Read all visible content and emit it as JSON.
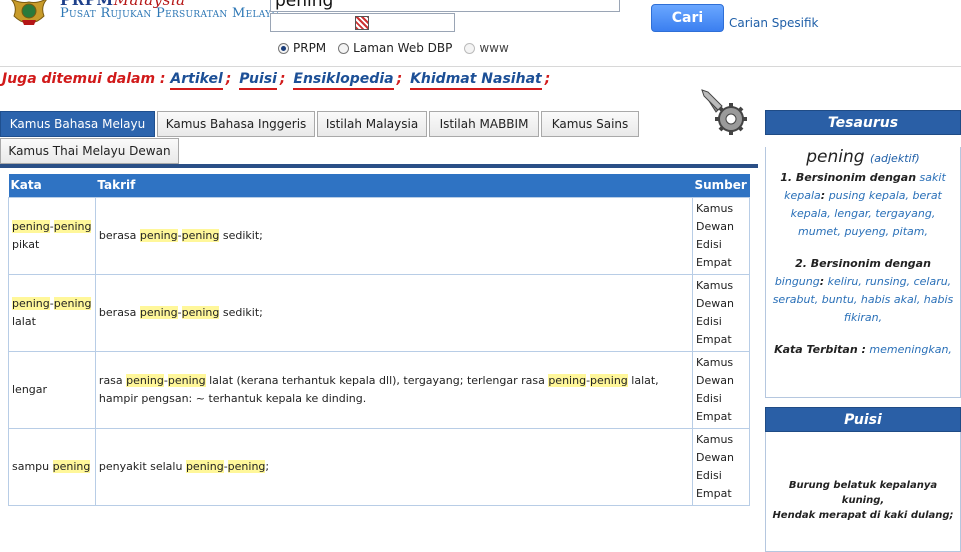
{
  "header": {
    "logo_main": "PRPM",
    "logo_tag": "Malaysia",
    "logo_sub": "Pusat Rujukan Persuratan Melayu",
    "search_value": "pening",
    "search_button": "Cari",
    "specific_link": "Carian Spesifik",
    "radios": [
      {
        "label": "PRPM",
        "checked": true
      },
      {
        "label": "Laman Web DBP",
        "checked": false
      },
      {
        "label": "www",
        "checked": false
      }
    ]
  },
  "also_found": {
    "prefix": "Juga ditemui dalam :",
    "links": [
      "Artikel",
      "Puisi",
      "Ensiklopedia",
      "Khidmat Nasihat"
    ],
    "sep": ";"
  },
  "tabs": [
    {
      "label": "Kamus Bahasa Melayu",
      "active": true
    },
    {
      "label": "Kamus Bahasa Inggeris",
      "active": false
    },
    {
      "label": "Istilah Malaysia",
      "active": false
    },
    {
      "label": "Istilah MABBIM",
      "active": false
    },
    {
      "label": "Kamus Sains",
      "active": false
    },
    {
      "label": "Kamus Thai Melayu Dewan",
      "active": false
    }
  ],
  "table": {
    "headers": {
      "kata": "Kata",
      "takrif": "Takrif",
      "sumber": "Sumber"
    },
    "rows": [
      {
        "kata": {
          "hl1": "pening",
          "dash": "-",
          "hl2": "pening",
          "rest": " pikat"
        },
        "takrif": {
          "pre": "berasa ",
          "hl1": "pening",
          "dash": "-",
          "hl2": "pening",
          "post": " sedikit;"
        },
        "sumber": [
          "Kamus",
          "Dewan",
          "Edisi",
          "Empat"
        ]
      },
      {
        "kata": {
          "hl1": "pening",
          "dash": "-",
          "hl2": "pening",
          "rest": " lalat"
        },
        "takrif": {
          "pre": "berasa ",
          "hl1": "pening",
          "dash": "-",
          "hl2": "pening",
          "post": " sedikit;"
        },
        "sumber": [
          "Kamus",
          "Dewan",
          "Edisi",
          "Empat"
        ]
      },
      {
        "kata": {
          "plain": "lengar"
        },
        "takrif": {
          "pre": "rasa ",
          "hl1": "pening",
          "dash": "-",
          "hl2": "pening",
          "mid": " lalat (kerana terhantuk kepala dll), tergayang; terlengar rasa ",
          "hl3": "pening",
          "dash2": "-",
          "hl4": "pening",
          "post": " lalat, hampir pengsan: ~ terhantuk kepala ke dinding."
        },
        "sumber": [
          "Kamus",
          "Dewan",
          "Edisi",
          "Empat"
        ]
      },
      {
        "kata": {
          "plain": "sampu ",
          "hl1": "pening"
        },
        "takrif": {
          "pre": "penyakit selalu ",
          "hl1": "pening",
          "dash": "-",
          "hl2": "pening",
          "post": ";"
        },
        "sumber": [
          "Kamus",
          "Dewan",
          "Edisi",
          "Empat"
        ]
      }
    ]
  },
  "tesaurus": {
    "title": "Tesaurus",
    "word": "pening",
    "pos": "(adjektif)",
    "s1_label": "1. Bersinonim dengan",
    "s1_head": "sakit kepala",
    "s1_list": "pusing kepala, berat kepala, lengar, tergayang, mumet, puyeng, pitam,",
    "s2_label": "2. Bersinonim dengan",
    "s2_head": "bingung",
    "s2_list": "keliru, runsing, celaru, serabut, buntu, habis akal, habis fikiran,",
    "derived_label": "Kata Terbitan :",
    "derived_list": "memeningkan,"
  },
  "puisi": {
    "title": "Puisi",
    "lines": [
      "Burung belatuk kepalanya kuning,",
      "Hendak merapat di kaki dulang;"
    ]
  },
  "colors": {
    "accent": "#2a5fa6",
    "highlight": "#fff79a",
    "red": "#d11a1a",
    "link": "#1c4f96"
  }
}
